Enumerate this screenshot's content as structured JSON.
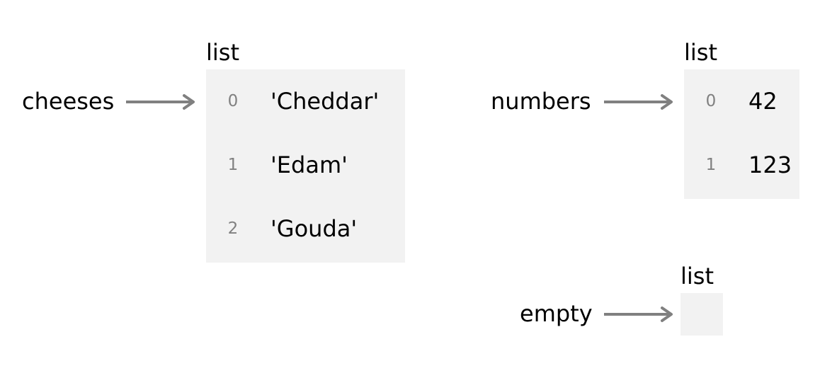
{
  "colors": {
    "box": "#f2f2f2",
    "arrow": "#808080",
    "index": "#808080",
    "text": "#000000"
  },
  "frames": [
    {
      "var": "cheeses",
      "type": "list",
      "items": [
        {
          "index": "0",
          "value": "'Cheddar'"
        },
        {
          "index": "1",
          "value": "'Edam'"
        },
        {
          "index": "2",
          "value": "'Gouda'"
        }
      ]
    },
    {
      "var": "numbers",
      "type": "list",
      "items": [
        {
          "index": "0",
          "value": "42"
        },
        {
          "index": "1",
          "value": "123"
        }
      ]
    },
    {
      "var": "empty",
      "type": "list",
      "items": []
    }
  ]
}
